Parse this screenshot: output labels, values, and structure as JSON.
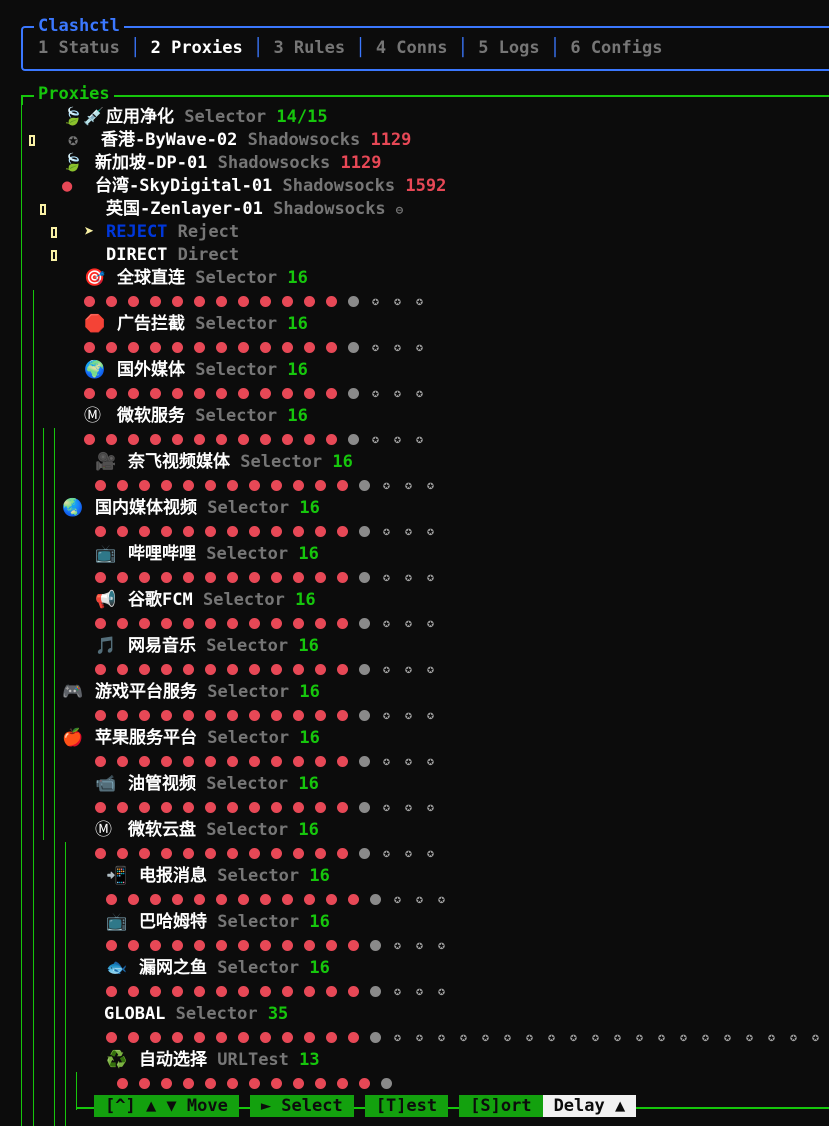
{
  "app": {
    "title": "Clashctl",
    "tabs": [
      "1 Status",
      "2 Proxies",
      "3 Rules",
      "4 Conns",
      "5 Logs",
      "6 Configs"
    ],
    "active_tab": "2 Proxies"
  },
  "panel": {
    "title": "Proxies"
  },
  "top_group": {
    "icon": "🍃💉",
    "name": "应用净化",
    "type": "Selector",
    "count": "14/15",
    "items": [
      {
        "icon": "✪",
        "name": "香港-ByWave-02",
        "type": "Shadowsocks",
        "latency": "1129",
        "marker": true
      },
      {
        "icon": "🍃",
        "name": "新加坡-DP-01",
        "type": "Shadowsocks",
        "latency": "1129",
        "marker": false
      },
      {
        "icon": "●",
        "name": "台湾-SkyDigital-01",
        "type": "Shadowsocks",
        "latency": "1592",
        "marker": false
      },
      {
        "icon": "",
        "name": "英国-Zenlayer-01",
        "type": "Shadowsocks",
        "latency": "⊖",
        "marker": true
      },
      {
        "icon": "➤",
        "name": "REJECT",
        "type": "Reject",
        "latency": "",
        "marker": true
      },
      {
        "icon": "",
        "name": "DIRECT",
        "type": "Direct",
        "latency": "",
        "marker": true
      }
    ]
  },
  "groups": [
    {
      "icon": "🎯",
      "name": "全球直连",
      "type": "Selector",
      "count": "16",
      "red": 12,
      "grey": 1,
      "star": 3
    },
    {
      "icon": "🛑",
      "name": "广告拦截",
      "type": "Selector",
      "count": "16",
      "red": 12,
      "grey": 1,
      "star": 3
    },
    {
      "icon": "🌍",
      "name": "国外媒体",
      "type": "Selector",
      "count": "16",
      "red": 12,
      "grey": 1,
      "star": 3
    },
    {
      "icon": "Ⓜ",
      "name": "微软服务",
      "type": "Selector",
      "count": "16",
      "red": 12,
      "grey": 1,
      "star": 3
    },
    {
      "icon": "🎥",
      "name": "奈飞视频媒体",
      "type": "Selector",
      "count": "16",
      "red": 12,
      "grey": 1,
      "star": 3
    },
    {
      "icon": "🌏",
      "name": "国内媒体视频",
      "type": "Selector",
      "count": "16",
      "red": 12,
      "grey": 1,
      "star": 3
    },
    {
      "icon": "📺",
      "name": "哔哩哔哩",
      "type": "Selector",
      "count": "16",
      "red": 12,
      "grey": 1,
      "star": 3
    },
    {
      "icon": "📢",
      "name": "谷歌FCM",
      "type": "Selector",
      "count": "16",
      "red": 12,
      "grey": 1,
      "star": 3
    },
    {
      "icon": "🎵",
      "name": "网易音乐",
      "type": "Selector",
      "count": "16",
      "red": 12,
      "grey": 1,
      "star": 3
    },
    {
      "icon": "🎮",
      "name": "游戏平台服务",
      "type": "Selector",
      "count": "16",
      "red": 12,
      "grey": 1,
      "star": 3
    },
    {
      "icon": "🍎",
      "name": "苹果服务平台",
      "type": "Selector",
      "count": "16",
      "red": 12,
      "grey": 1,
      "star": 3
    },
    {
      "icon": "📹",
      "name": "油管视频",
      "type": "Selector",
      "count": "16",
      "red": 12,
      "grey": 1,
      "star": 3
    },
    {
      "icon": "Ⓜ",
      "name": "微软云盘",
      "type": "Selector",
      "count": "16",
      "red": 12,
      "grey": 1,
      "star": 3
    },
    {
      "icon": "📲",
      "name": "电报消息",
      "type": "Selector",
      "count": "16",
      "red": 12,
      "grey": 1,
      "star": 3
    },
    {
      "icon": "📺",
      "name": "巴哈姆特",
      "type": "Selector",
      "count": "16",
      "red": 12,
      "grey": 1,
      "star": 3
    },
    {
      "icon": "🐟",
      "name": "漏网之鱼",
      "type": "Selector",
      "count": "16",
      "red": 12,
      "grey": 1,
      "star": 3
    },
    {
      "icon": "",
      "name": "GLOBAL",
      "type": "Selector",
      "count": "35",
      "red": 12,
      "grey": 1,
      "star": 22
    },
    {
      "icon": "♻️",
      "name": "自动选择",
      "type": "URLTest",
      "count": "13",
      "red": 12,
      "grey": 1,
      "star": 0
    }
  ],
  "footer": {
    "move": "[^] ▲ ▼ Move",
    "select": "► Select",
    "test": "[T]est",
    "sort": "[S]ort",
    "sort_mode": "Delay ▲"
  },
  "colors": {
    "accent_blue": "#3b78ff",
    "accent_green": "#16c60c",
    "latency_red": "#e74856",
    "marker_yellow": "#f9f1a5"
  }
}
